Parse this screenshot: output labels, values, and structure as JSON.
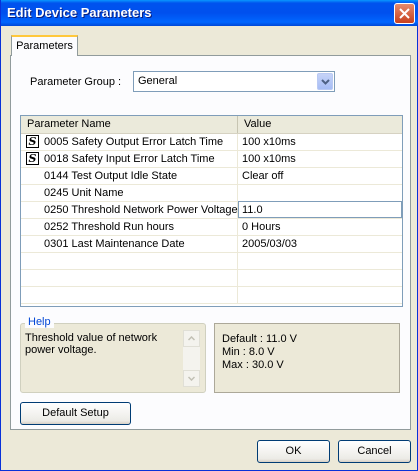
{
  "window": {
    "title": "Edit Device Parameters"
  },
  "tabs": [
    {
      "label": "Parameters"
    }
  ],
  "parameter_group": {
    "label": "Parameter Group :",
    "selected": "General"
  },
  "grid": {
    "columns": [
      "Parameter Name",
      "Value"
    ],
    "rows": [
      {
        "icon": "S",
        "name": "0005 Safety Output Error Latch Time",
        "value": "100 x10ms"
      },
      {
        "icon": "S",
        "name": "0018 Safety Input Error Latch Time",
        "value": "100 x10ms"
      },
      {
        "icon": "",
        "name": "0144 Test Output Idle State",
        "value": "Clear off"
      },
      {
        "icon": "",
        "name": "0245 Unit Name",
        "value": ""
      },
      {
        "icon": "",
        "name": "0250 Threshold Network Power Voltage",
        "value": "11.0"
      },
      {
        "icon": "",
        "name": "0252 Threshold Run hours",
        "value": "0 Hours"
      },
      {
        "icon": "",
        "name": "0301 Last Maintenance Date",
        "value": "2005/03/03"
      }
    ]
  },
  "help": {
    "title": "Help",
    "text": "Threshold value of network power voltage."
  },
  "info": {
    "default": "Default : 11.0 V",
    "min": "Min : 8.0 V",
    "max": "Max : 30.0 V"
  },
  "buttons": {
    "default_setup": "Default Setup",
    "ok": "OK",
    "cancel": "Cancel"
  },
  "colors": {
    "title_bar": "#0053ee",
    "tab_accent": "#ffc83c",
    "help_title": "#0046d5"
  }
}
